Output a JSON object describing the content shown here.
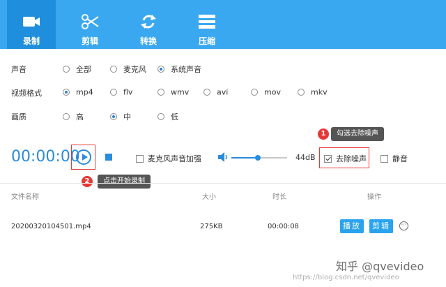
{
  "toolbar": {
    "tabs": [
      {
        "label": "录制",
        "icon": "video-camera-icon",
        "active": true
      },
      {
        "label": "剪辑",
        "icon": "scissors-icon",
        "active": false
      },
      {
        "label": "转换",
        "icon": "convert-arrows-icon",
        "active": false
      },
      {
        "label": "压缩",
        "icon": "compress-icon",
        "active": false
      }
    ],
    "bg_color": "#3aa8f0",
    "active_color": "#1f8fdd"
  },
  "settings": {
    "audio": {
      "label": "声音",
      "options": [
        "全部",
        "麦克风",
        "系统声音"
      ],
      "selected": "系统声音"
    },
    "format": {
      "label": "视频格式",
      "options": [
        "mp4",
        "flv",
        "wmv",
        "avi",
        "mov",
        "mkv"
      ],
      "selected": "mp4"
    },
    "quality": {
      "label": "画质",
      "options": [
        "高",
        "中",
        "低"
      ],
      "selected": "中"
    }
  },
  "recorder": {
    "timer": "00:00:00",
    "mic_boost_label": "麦克风声音加强",
    "volume_db": "44dB",
    "volume_level": 0.47,
    "denoise_label": "去除噪声",
    "mute_label": "静音",
    "accent": "#2a8cdc"
  },
  "annotations": [
    {
      "number": "1",
      "text": "勾选去除噪声"
    },
    {
      "number": "2",
      "text": "点击开始录制"
    }
  ],
  "table": {
    "headers": [
      "文件名称",
      "大小",
      "时长",
      "操作"
    ],
    "rows": [
      {
        "name": "20200320104501.mp4",
        "size": "275KB",
        "duration": "00:00:08"
      }
    ],
    "play_label": "播放",
    "edit_label": "剪辑",
    "more_icon": "more-ellipsis-icon"
  },
  "watermark": {
    "main": "知乎 @qvevideo",
    "sub": "https://blog.csdn.net/qvevideo"
  }
}
